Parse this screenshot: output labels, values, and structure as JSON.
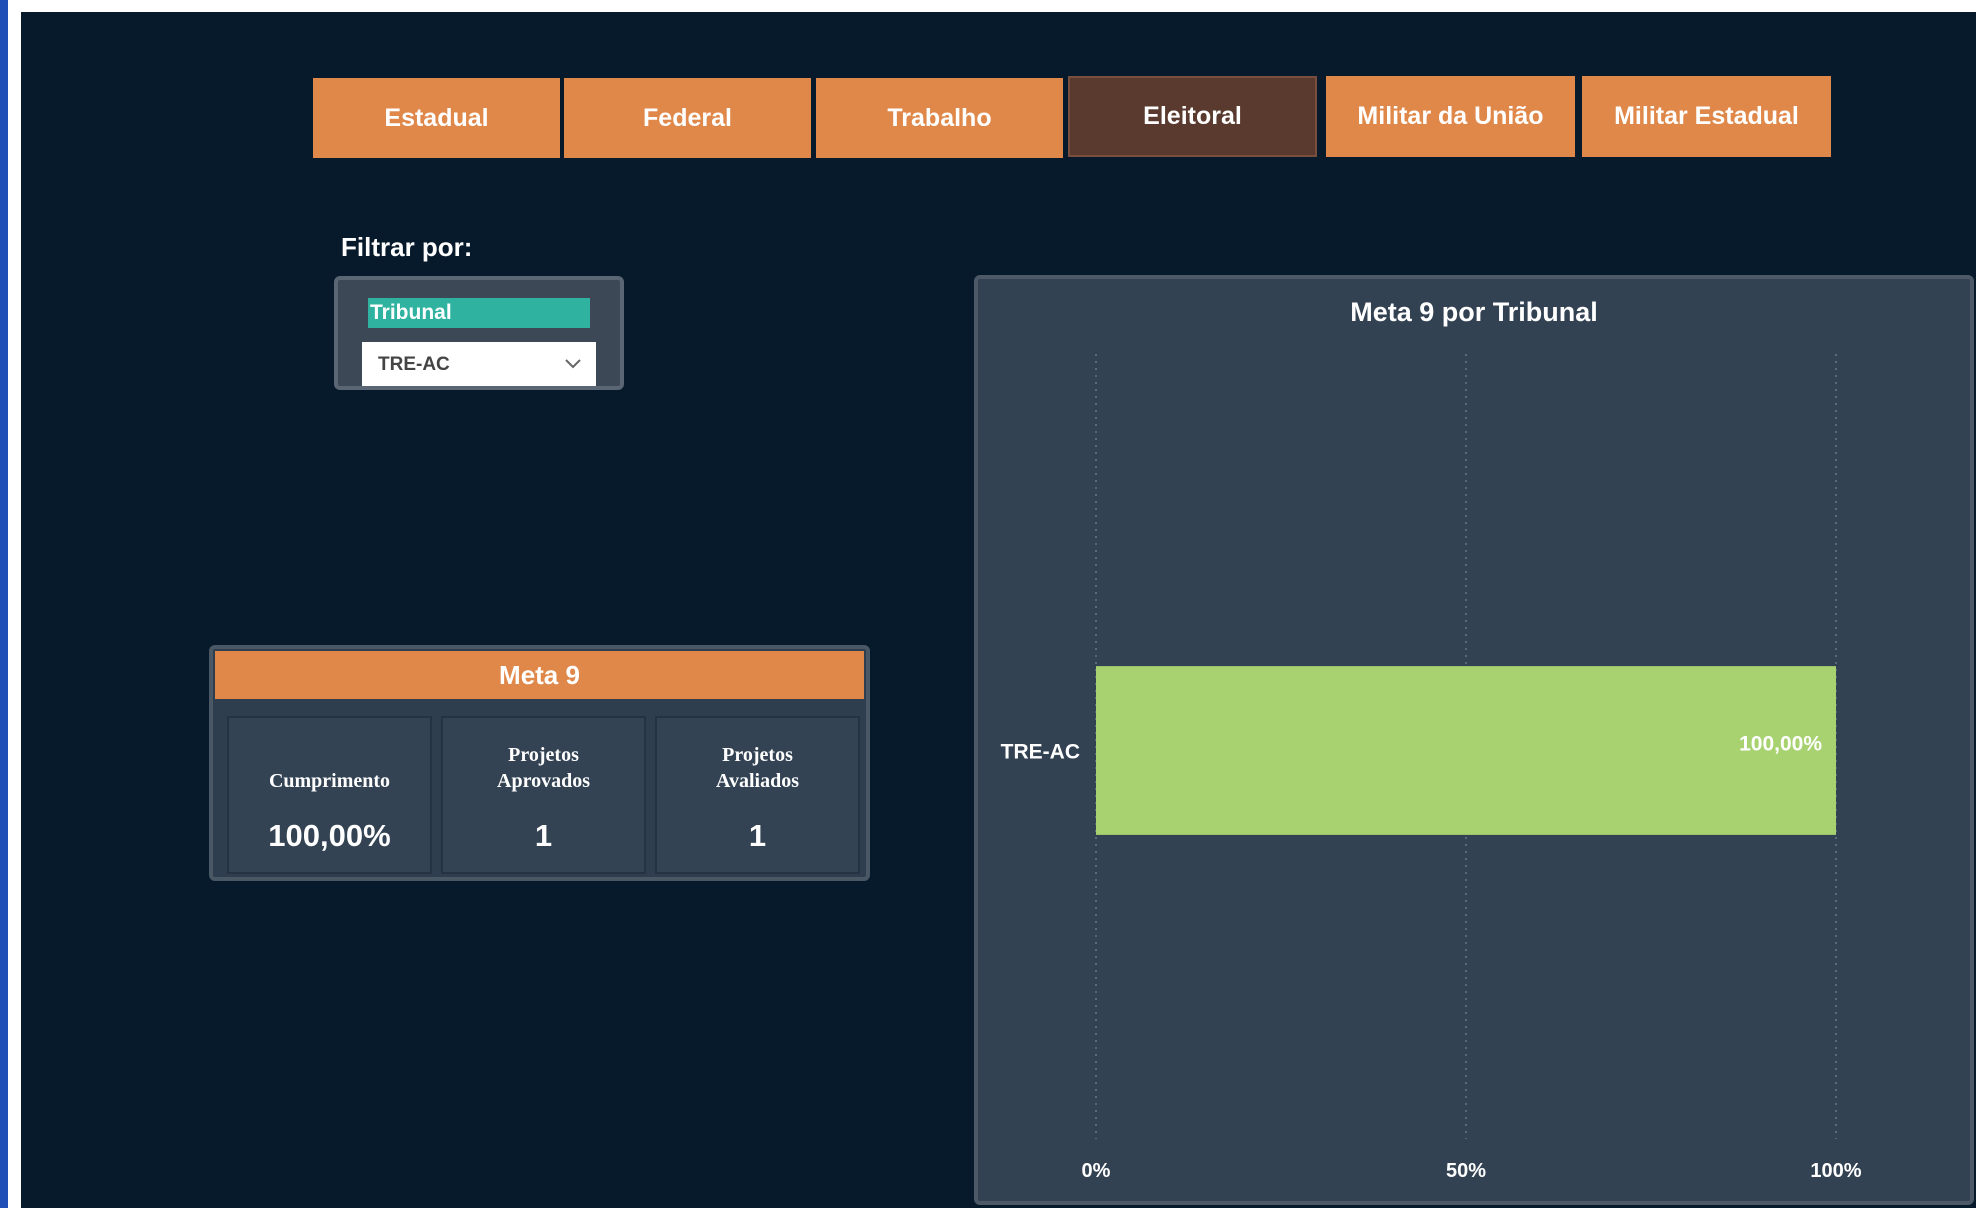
{
  "tabs": [
    {
      "label": "Estadual",
      "active": false
    },
    {
      "label": "Federal",
      "active": false
    },
    {
      "label": "Trabalho",
      "active": false
    },
    {
      "label": "Eleitoral",
      "active": true
    },
    {
      "label": "Militar da União",
      "active": false
    },
    {
      "label": "Militar Estadual",
      "active": false
    }
  ],
  "filter": {
    "label": "Filtrar por:",
    "header": "Tribunal",
    "selected": "TRE-AC",
    "icon": "chevron-down-icon"
  },
  "kpi": {
    "title": "Meta 9",
    "cells": [
      {
        "label_line1": "Cumprimento",
        "label_line2": "",
        "value": "100,00%"
      },
      {
        "label_line1": "Projetos",
        "label_line2": "Aprovados",
        "value": "1"
      },
      {
        "label_line1": "Projetos",
        "label_line2": "Avaliados",
        "value": "1"
      }
    ]
  },
  "colors": {
    "accent": "#e0884a",
    "active_tab": "#5a3a2f",
    "filter_header": "#2fb3a0",
    "bar": "#a8d270",
    "background": "#071a2b",
    "panel": "#334253"
  },
  "chart_data": {
    "type": "bar",
    "orientation": "horizontal",
    "title": "Meta 9 por Tribunal",
    "categories": [
      "TRE-AC"
    ],
    "values": [
      100
    ],
    "data_labels": [
      "100,00%"
    ],
    "xlim": [
      0,
      100
    ],
    "xticks": [
      0,
      50,
      100
    ],
    "xtick_labels": [
      "0%",
      "50%",
      "100%"
    ],
    "grid": "vertical dotted",
    "legend": "none"
  }
}
